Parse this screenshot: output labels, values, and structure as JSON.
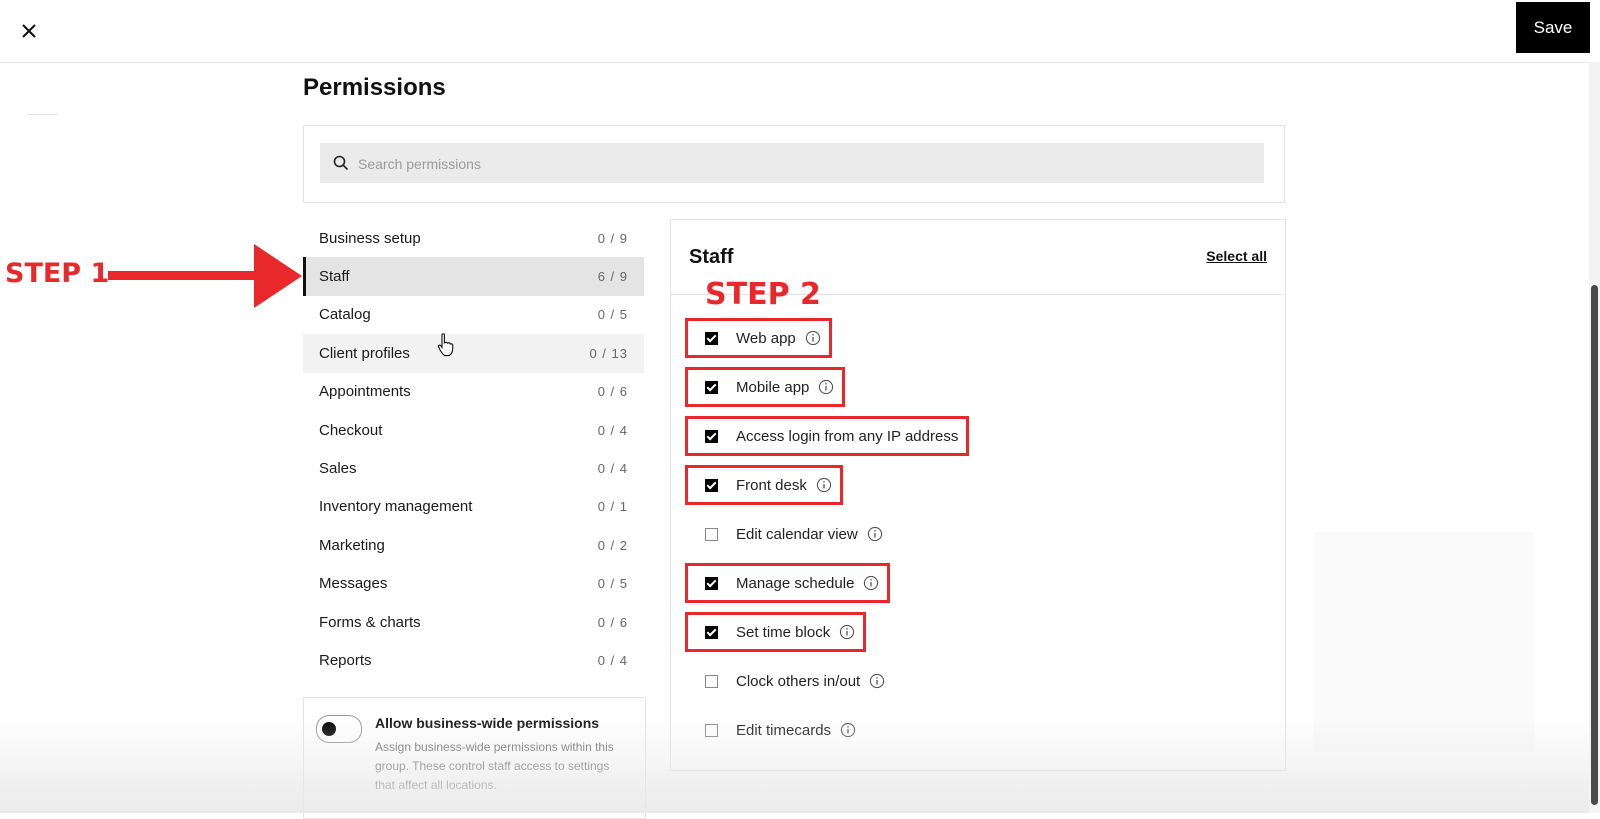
{
  "topbar": {
    "close_icon": "close-icon",
    "save_label": "Save"
  },
  "page": {
    "title": "Permissions"
  },
  "search": {
    "placeholder": "Search permissions",
    "value": ""
  },
  "categories": [
    {
      "label": "Business setup",
      "count": "0 / 9",
      "state": "default"
    },
    {
      "label": "Staff",
      "count": "6 / 9",
      "state": "active"
    },
    {
      "label": "Catalog",
      "count": "0 / 5",
      "state": "default"
    },
    {
      "label": "Client profiles",
      "count": "0 / 13",
      "state": "hover"
    },
    {
      "label": "Appointments",
      "count": "0 / 6",
      "state": "default"
    },
    {
      "label": "Checkout",
      "count": "0 / 4",
      "state": "default"
    },
    {
      "label": "Sales",
      "count": "0 / 4",
      "state": "default"
    },
    {
      "label": "Inventory management",
      "count": "0 / 1",
      "state": "default"
    },
    {
      "label": "Marketing",
      "count": "0 / 2",
      "state": "default"
    },
    {
      "label": "Messages",
      "count": "0 / 5",
      "state": "default"
    },
    {
      "label": "Forms & charts",
      "count": "0 / 6",
      "state": "default"
    },
    {
      "label": "Reports",
      "count": "0 / 4",
      "state": "default"
    }
  ],
  "business_wide": {
    "title": "Allow business-wide permissions",
    "description": "Assign business-wide permissions within this group. These control staff access to settings that affect all locations.",
    "enabled": false
  },
  "panel": {
    "title": "Staff",
    "select_all": "Select all",
    "permissions": [
      {
        "label": "Web app",
        "checked": true,
        "info": true,
        "highlighted": true
      },
      {
        "label": "Mobile app",
        "checked": true,
        "info": true,
        "highlighted": true
      },
      {
        "label": "Access login from any IP address",
        "checked": true,
        "info": false,
        "highlighted": true
      },
      {
        "label": "Front desk",
        "checked": true,
        "info": true,
        "highlighted": true
      },
      {
        "label": "Edit calendar view",
        "checked": false,
        "info": true,
        "highlighted": false
      },
      {
        "label": "Manage schedule",
        "checked": true,
        "info": true,
        "highlighted": true
      },
      {
        "label": "Set time block",
        "checked": true,
        "info": true,
        "highlighted": true
      },
      {
        "label": "Clock others in/out",
        "checked": false,
        "info": true,
        "highlighted": false
      },
      {
        "label": "Edit timecards",
        "checked": false,
        "info": true,
        "highlighted": false
      }
    ]
  },
  "annotations": {
    "step1": "STEP 1",
    "step2": "STEP 2",
    "color": "#e8282b"
  }
}
